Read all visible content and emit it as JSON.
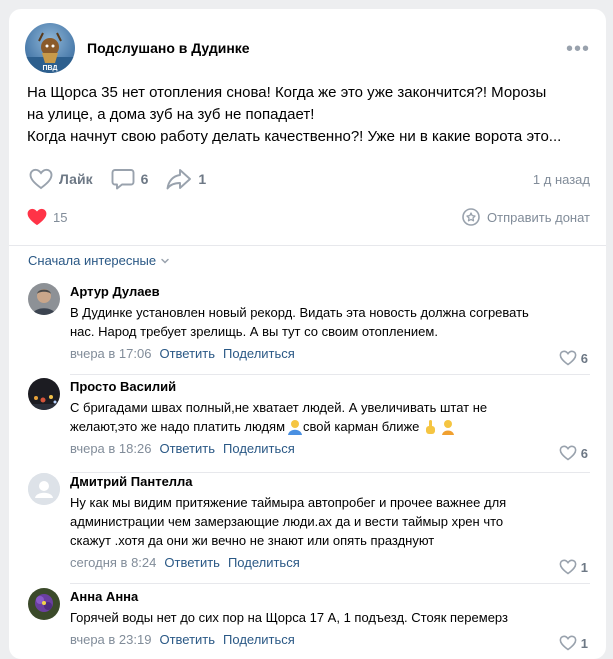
{
  "post": {
    "group_name": "Подслушано в Дудинке",
    "group_avatar_text": "ПВД",
    "text_lines": [
      "На Щорса 35 нет отопления снова! Когда же это уже закончится?! Морозы",
      "на улице, а дома зуб на зуб не попадает!",
      "Когда начнут свою работу делать качественно?! Уже ни в какие ворота это..."
    ],
    "like_label": "Лайк",
    "comments_count": "6",
    "shares_count": "1",
    "time": "1 д назад",
    "reactions_count": "15",
    "donate_label": "Отправить донат"
  },
  "comments_section": {
    "sort_label": "Сначала интересные",
    "items": [
      {
        "author": "Артур Дулаев",
        "text_lines": [
          "В Дудинке установлен новый рекорд. Видать эта новость должна согревать",
          "нас. Народ требует зрелищь. А вы тут со своим отоплением."
        ],
        "date": "вчера в 17:06",
        "reply": "Ответить",
        "share": "Поделиться",
        "likes": "6"
      },
      {
        "author": "Просто Василий",
        "text_lines": [
          "С бригадами швах полный,не хватает людей. А увеличивать штат не",
          "желают,это же надо платить людям",
          " свой карман ближе"
        ],
        "date": "вчера в 18:26",
        "reply": "Ответить",
        "share": "Поделиться",
        "likes": "6"
      },
      {
        "author": "Дмитрий Пантелла",
        "text_lines": [
          "Ну как мы видим притяжение таймыра автопробег и прочее важнее для",
          "администрации чем замерзающие люди.ах да и вести таймыр хрен что",
          "скажут .хотя да они жи вечно не знают или опять празднуют"
        ],
        "date": "сегодня в 8:24",
        "reply": "Ответить",
        "share": "Поделиться",
        "likes": "1"
      },
      {
        "author": "Анна Анна",
        "text_lines": [
          "Горячей воды нет до сих пор на Щорса 17 А, 1 подъезд. Стояк перемерз"
        ],
        "date": "вчера в 23:19",
        "reply": "Ответить",
        "share": "Поделиться",
        "likes": "1"
      }
    ]
  },
  "colors": {
    "link": "#2a5885",
    "muted": "#818c99",
    "icon": "#99a2ad",
    "heart": "#ff3347"
  },
  "icons": {
    "like": "heart-outline-icon",
    "comment": "comment-bubble-icon",
    "share": "share-arrow-icon",
    "reaction": "heart-filled-icon",
    "donate": "donate-icon",
    "more": "more-dots-icon",
    "sort": "chevron-down-icon"
  }
}
